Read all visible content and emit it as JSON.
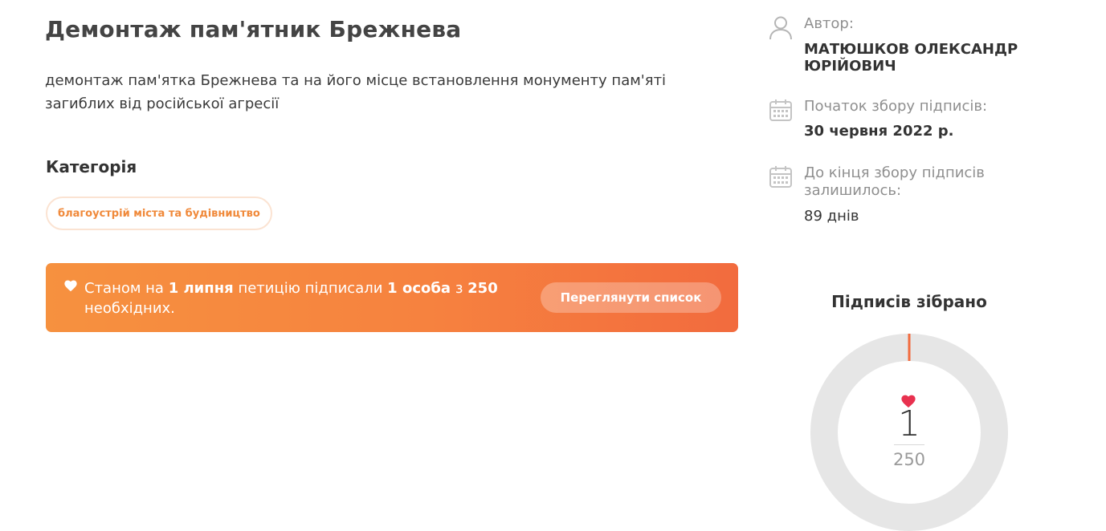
{
  "petition": {
    "title": "Демонтаж пам'ятник Брежнева",
    "description": "демонтаж пам'ятка Брежнева та на його місце встановлення монументу пам'яті загиблих від російської агресії"
  },
  "category": {
    "heading": "Категорія",
    "tag": "благоустрій міста та будівництво"
  },
  "status": {
    "prefix": "Станом на",
    "date": "1 липня",
    "middle": "петицію підписали",
    "signed": "1 особа",
    "connector": "з",
    "required": "250",
    "suffix": "необхідних.",
    "button_label": "Переглянути список"
  },
  "sidebar": {
    "author_label": "Автор:",
    "author_name": "МАТЮШКОВ ОЛЕКСАНДР ЮРІЙОВИЧ",
    "start_label": "Початок збору підписів:",
    "start_value": "30 червня 2022 р.",
    "remaining_label": "До кінця збору підписів залишилось:",
    "remaining_value": "89 днів"
  },
  "signatures": {
    "heading": "Підписів зібрано",
    "collected": "1",
    "goal": "250",
    "progress_fraction": 0.004
  },
  "colors": {
    "accent_orange": "#f6823f",
    "heart_red": "#e8314f",
    "ring_track": "#e6e6e6",
    "ring_progress": "#f26b3e"
  },
  "icons": {
    "author": "user-icon",
    "start": "calendar-icon",
    "end": "calendar-icon",
    "banner": "heart-icon",
    "ring": "heart-icon"
  }
}
